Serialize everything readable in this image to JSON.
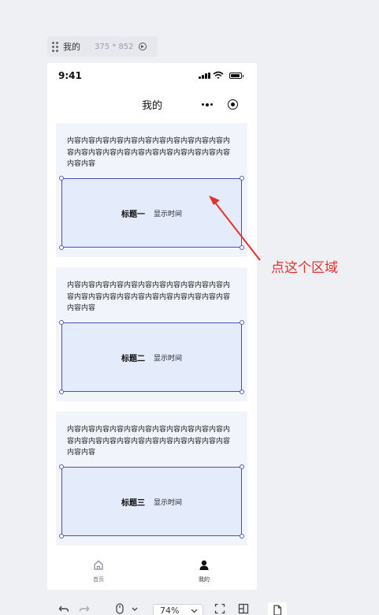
{
  "frame_chip": {
    "name": "我的",
    "size": "375 * 852",
    "icons": [
      "drag-grip-icon",
      "preview-play-icon"
    ]
  },
  "status_bar": {
    "time": "9:41",
    "icons": [
      "signal-icon",
      "wifi-icon",
      "battery-icon"
    ]
  },
  "nav": {
    "title": "我的",
    "icons": [
      "more-dots-icon",
      "capsule-close-icon"
    ]
  },
  "cards": [
    {
      "content": "内容内容内容内容内容内容内容内容内容内容内容内容内容内容内容内容内容内容内容内容内容内容内容内容内容",
      "title": "标题一",
      "time": "显示时间"
    },
    {
      "content": "内容内容内容内容内容内容内容内容内容内容内容内容内容内容内容内容内容内容内容内容内容内容内容内容内容",
      "title": "标题二",
      "time": "显示时间"
    },
    {
      "content": "内容内容内容内容内容内容内容内容内容内容内容内容内容内容内容内容内容内容内容内容内容内容内容内容内容",
      "title": "标题三",
      "time": "显示时间"
    }
  ],
  "tabbar": {
    "items": [
      {
        "label": "首页",
        "icon": "home-icon",
        "active": false
      },
      {
        "label": "我的",
        "icon": "user-icon",
        "active": true
      }
    ]
  },
  "annotation": {
    "text": "点这个区域",
    "color": "#e8302a"
  },
  "toolbar": {
    "zoom": "74%",
    "icons": [
      "undo-icon",
      "redo-icon",
      "mouse-icon",
      "chevron-down-icon",
      "fit-screen-icon",
      "layout-icon",
      "file-icon"
    ]
  },
  "colors": {
    "region_border": "#4b4fb4",
    "region_fill": "#e4ebfb",
    "card_fill": "#f1f4fb"
  }
}
